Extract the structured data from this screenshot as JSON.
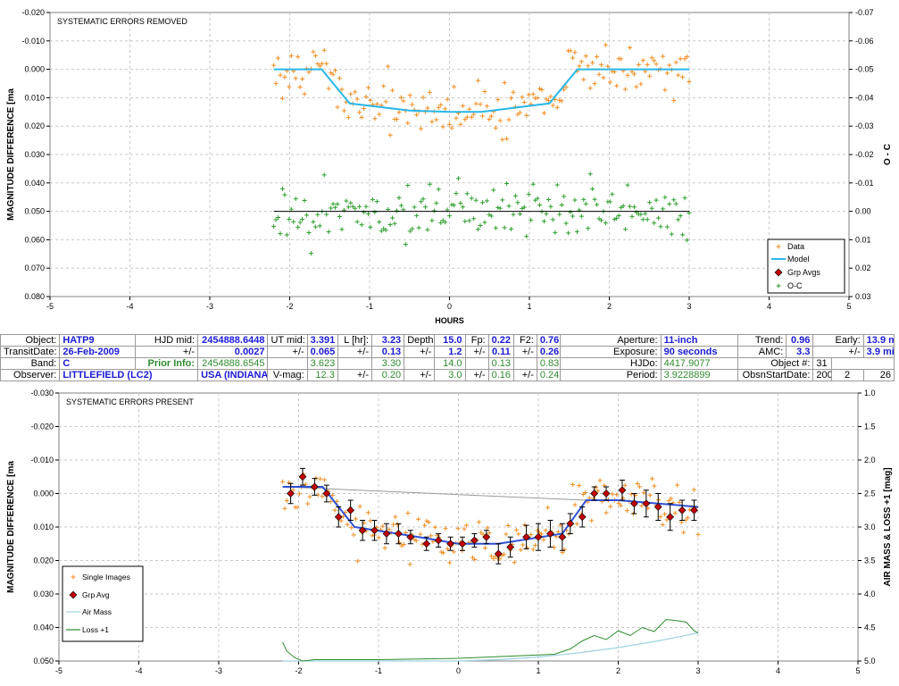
{
  "colors": {
    "data": "#f28c1e",
    "model": "#29b6e8",
    "grp": "#c00000",
    "oc": "#2e9e2e",
    "loss": "#2c8c2c",
    "airmass": "#9fd2e0",
    "bottom_model": "#3050d8",
    "gray_line": "#999999"
  },
  "chart_data": [
    {
      "type": "scatter",
      "title": "SYSTEMATIC ERRORS REMOVED",
      "xlabel": "HOURS",
      "ylabel": "MAGNITUDE DIFFERENCE [ma",
      "y2label": "O - C",
      "xlim": [
        -5,
        5
      ],
      "ylim": [
        -0.02,
        0.08
      ],
      "y_inverted": true,
      "y2lim": [
        -0.07,
        0.03
      ],
      "x_ticks": [
        "-5",
        "-4",
        "-3",
        "-2",
        "-1",
        "0",
        "1",
        "2",
        "3",
        "4",
        "5"
      ],
      "y_ticks": [
        "-0.020",
        "-0.010",
        "0.000",
        "0.010",
        "0.020",
        "0.030",
        "0.040",
        "0.050",
        "0.060",
        "0.070",
        "0.080"
      ],
      "y2_ticks": [
        "-0.07",
        "-0.06",
        "-0.05",
        "-0.04",
        "-0.03",
        "-0.02",
        "-0.01",
        "0.00",
        "0.01",
        "0.02",
        "0.03"
      ],
      "grid": true,
      "legend_position": "bottom-right",
      "legend": [
        "Data",
        "Model",
        "Grp Avgs",
        "O-C"
      ],
      "model": {
        "x": [
          -2.2,
          -1.6,
          -1.25,
          -0.5,
          0.0,
          0.4,
          1.25,
          1.6,
          3.0
        ],
        "y": [
          0.0,
          0.0,
          0.012,
          0.0145,
          0.015,
          0.015,
          0.012,
          0.0,
          0.0
        ]
      },
      "data_series": {
        "name": "Data",
        "x_range": [
          -2.2,
          3.0
        ],
        "count": 190,
        "scatter_sigma": 0.0045
      },
      "oc_series": {
        "name": "O-C",
        "x_range": [
          -2.2,
          3.0
        ],
        "count": 190,
        "offset": 0.05,
        "scatter_sigma": 0.0045
      },
      "oc_zero_line": 0.05
    },
    {
      "type": "scatter",
      "title": "SYSTEMATIC ERRORS PRESENT",
      "xlabel": "",
      "ylabel": "MAGNITUDE DIFFERENCE [ma",
      "y2label": "AIR MASS & LOSS +1 [mag]",
      "xlim": [
        -5,
        5
      ],
      "ylim": [
        -0.03,
        0.05
      ],
      "y_inverted": true,
      "y2lim": [
        1.0,
        5.0
      ],
      "x_ticks": [
        "-5",
        "-4",
        "-3",
        "-2",
        "-1",
        "0",
        "1",
        "2",
        "3",
        "4",
        "5"
      ],
      "y_ticks": [
        "-0.030",
        "-0.020",
        "-0.010",
        "0.000",
        "0.010",
        "0.020",
        "0.030",
        "0.040",
        "0.050"
      ],
      "y2_ticks": [
        "1.0",
        "1.5",
        "2.0",
        "2.5",
        "3.0",
        "3.5",
        "4.0",
        "4.5",
        "5.0"
      ],
      "grid": true,
      "legend_position": "bottom-left",
      "legend": [
        "Single Images",
        "Grp Avg",
        "Air Mass",
        "Loss +1"
      ],
      "grp_avg": {
        "x": [
          -2.1,
          -1.95,
          -1.8,
          -1.65,
          -1.5,
          -1.35,
          -1.2,
          -1.05,
          -0.9,
          -0.75,
          -0.6,
          -0.4,
          -0.25,
          -0.1,
          0.05,
          0.2,
          0.35,
          0.5,
          0.65,
          0.85,
          1.0,
          1.15,
          1.3,
          1.4,
          1.55,
          1.7,
          1.85,
          2.05,
          2.2,
          2.35,
          2.5,
          2.65,
          2.8,
          2.95
        ],
        "y": [
          0.0,
          -0.005,
          -0.002,
          0.0,
          0.007,
          0.005,
          0.011,
          0.011,
          0.012,
          0.012,
          0.013,
          0.015,
          0.014,
          0.015,
          0.015,
          0.014,
          0.013,
          0.018,
          0.016,
          0.013,
          0.013,
          0.012,
          0.013,
          0.009,
          0.007,
          0.0,
          0.0,
          -0.001,
          0.003,
          0.003,
          0.004,
          0.007,
          0.005,
          0.005
        ],
        "err": [
          0.003,
          0.0025,
          0.0025,
          0.0025,
          0.003,
          0.003,
          0.003,
          0.003,
          0.003,
          0.003,
          0.002,
          0.002,
          0.002,
          0.002,
          0.002,
          0.002,
          0.002,
          0.003,
          0.003,
          0.0035,
          0.004,
          0.004,
          0.004,
          0.003,
          0.003,
          0.002,
          0.002,
          0.003,
          0.003,
          0.004,
          0.004,
          0.004,
          0.003,
          0.003
        ]
      },
      "model": {
        "x": [
          -2.2,
          -1.7,
          -1.3,
          -0.5,
          0.0,
          0.5,
          1.3,
          1.6,
          2.0,
          3.0
        ],
        "y": [
          -0.002,
          -0.002,
          0.01,
          0.013,
          0.015,
          0.015,
          0.012,
          0.002,
          0.002,
          0.004
        ]
      },
      "gray_line": {
        "x": [
          -2.2,
          1.6
        ],
        "y": [
          -0.002,
          0.002
        ]
      },
      "air_mass": {
        "x": [
          -2.2,
          -1.5,
          0.0,
          0.5,
          1.0,
          1.5,
          2.0,
          2.5,
          3.0
        ],
        "y": [
          1.0,
          1.0,
          1.0,
          1.02,
          1.06,
          1.12,
          1.2,
          1.3,
          1.42
        ]
      },
      "loss": {
        "x": [
          -2.2,
          -2.15,
          -2.05,
          -1.95,
          -1.8,
          -1.0,
          0.0,
          1.2,
          1.4,
          1.55,
          1.7,
          1.85,
          2.0,
          2.15,
          2.3,
          2.45,
          2.6,
          2.75,
          2.85,
          2.95,
          3.0
        ],
        "y": [
          1.28,
          1.15,
          1.05,
          1.0,
          1.02,
          1.02,
          1.04,
          1.1,
          1.18,
          1.3,
          1.38,
          1.32,
          1.45,
          1.38,
          1.5,
          1.44,
          1.62,
          1.6,
          1.58,
          1.45,
          1.42
        ]
      },
      "single_images": {
        "name": "Single Images",
        "x_range": [
          -2.2,
          3.0
        ],
        "count": 200,
        "scatter_sigma": 0.0035
      }
    }
  ],
  "info": {
    "r1": {
      "l1": "Object:",
      "v1": "HATP9",
      "l2": "HJD mid:",
      "v2": "2454888.6448",
      "l3": "UT mid:",
      "v3": "3.391",
      "l4": "L [hr]:",
      "v4": "3.23",
      "l5": "Depth:",
      "v5": "15.0",
      "l6": "Fp:",
      "v6": "0.22",
      "l7": "F2:",
      "v7": "0.76",
      "l8": "Aperture:",
      "v8": "11-inch",
      "l9": "Trend:",
      "v9": "0.96",
      "l10": "Early:",
      "v10": "13.9",
      "u10": "min"
    },
    "r2": {
      "l1": "TransitDate:",
      "v1": "26-Feb-2009",
      "l2": "+/-",
      "v2": "0.0027",
      "l3": "+/-",
      "v3": "0.065",
      "l4": "+/-",
      "v4": "0.13",
      "l5": "+/-",
      "v5": "1.2",
      "l6": "+/-",
      "v6": "0.11",
      "l7": "+/-",
      "v7": "0.26",
      "l8": "Exposure:",
      "v8": "90 seconds",
      "l9": "AMC:",
      "v9": "3.3",
      "l10": "+/-",
      "v10": "3.9",
      "u10": "min"
    },
    "r3": {
      "l1": "Band:",
      "v1": "C",
      "l2": "Prior Info:",
      "v2": "2454888.6545",
      "v3": "3.623",
      "v4": "3.30",
      "v5": "14.0",
      "v6": "0.13",
      "v7": "0.83",
      "l8": "HJDo:",
      "v8": "4417.9077",
      "l9": "Object #:",
      "v9": "31"
    },
    "r4": {
      "l1": "Observer:",
      "v1": "LITTLEFIELD (LC2)",
      "v2": "USA (INDIANA)",
      "l3": "V-mag:",
      "v3": "12.3",
      "l4": "+/-",
      "v4": "0.20",
      "l5": "+/-",
      "v5": "3.0",
      "l6": "+/-",
      "v6": "0.16",
      "l7": "+/-",
      "v7": "0.24",
      "l8": "Period:",
      "v8": "3.9228899",
      "l9": "ObsnStartDate:",
      "v9a": "2009",
      "v9b": "2",
      "v9c": "26"
    }
  }
}
